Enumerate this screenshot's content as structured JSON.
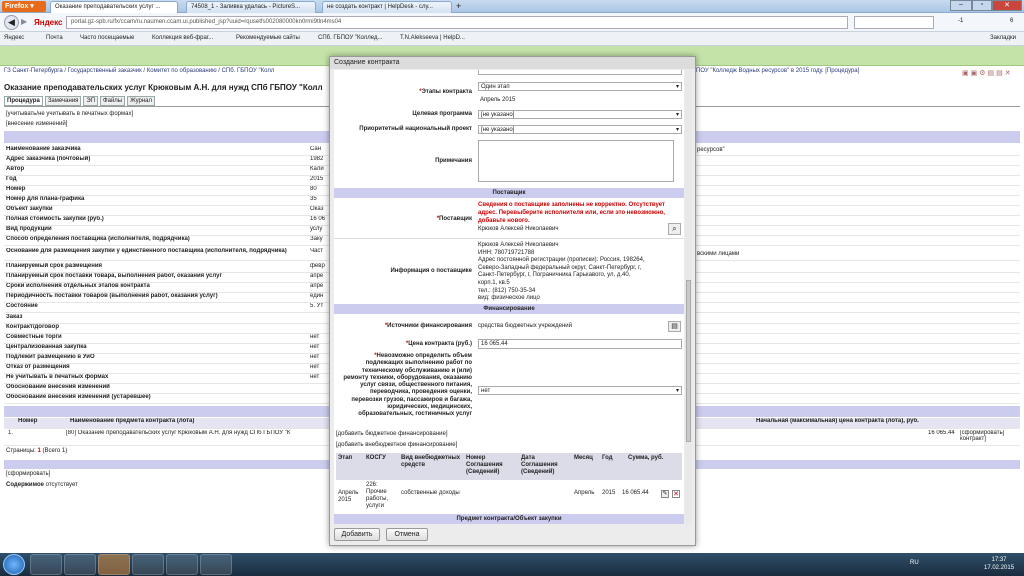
{
  "browser": {
    "brand": "Firefox",
    "tabs": [
      "Оказание преподавательских услуг ...",
      "74508_1 - Заливка удалась - PictureS...",
      "не создать контракт | HelpDesk - слу..."
    ],
    "url": "portal.gz-spb.ru/fx/ccam/ru.naumen.ccam.ui.published_jsp?uuid=rqusetfs002080000kn0rmi9tln4ms04",
    "search_engine": "Яндекс",
    "zoom": "-1",
    "bookmarks": [
      "Яндекс",
      "Почта",
      "Часто посещаемые",
      "Коллекция веб-фраг...",
      "Рекомендуемые сайты",
      "СПб. ГБПОУ \"Коллед...",
      "T.N.Alekseeva | HelpD..."
    ],
    "bookmarks_right": "Закладки",
    "badge": "6"
  },
  "breadcrumb": "ГЗ Санкт-Петербурга / Государственный заказчик / Комитет по образованию / СПб. ГБПОУ \"Колл",
  "breadcrumb_right": "ПОУ \"Колледж Водных ресурсов\" в 2015 году. [Процедура]",
  "page_title": "Оказание преподавательских услуг Крюковым А.Н. для нужд СПб ГБПОУ \"Колл",
  "tabs": [
    "Процедура",
    "Замечания",
    "ЭП",
    "Файлы",
    "Журнал"
  ],
  "notes": [
    "[учитывать/не учитывать в печатных формах]",
    "[внесение изменений]"
  ],
  "fields": [
    {
      "label": "Наименование заказчика",
      "value": "Сан"
    },
    {
      "label": "Адрес заказчика (почтовый)",
      "value": "1982"
    },
    {
      "label": "Автор",
      "value": "Кали"
    },
    {
      "label": "Год",
      "value": "2015"
    },
    {
      "label": "Номер",
      "value": "80"
    },
    {
      "label": "Номер для плана-графика",
      "value": "35"
    },
    {
      "label": "Объект закупки",
      "value": "Оказ"
    },
    {
      "label": "Полная стоимость закупки (руб.)",
      "value": "16 06"
    },
    {
      "label": "Вид продукции",
      "value": "услу"
    },
    {
      "label": "Способ определения поставщика (исполнителя, подрядчика)",
      "value": "Заку"
    },
    {
      "label": "Основание для размещения закупки у единственного поставщика (исполнителя, подрядчика)",
      "value": "Част"
    },
    {
      "label": "Планируемый срок размещения",
      "value": "февр"
    },
    {
      "label": "Планируемый срок поставки товара, выполнения работ, оказания услуг",
      "value": "апре"
    },
    {
      "label": "Сроки исполнения отдельных этапов контракта",
      "value": "апре"
    },
    {
      "label": "Периодичность поставки товаров (выполнения работ, оказания услуг)",
      "value": "един"
    },
    {
      "label": "Состояние",
      "value": "5. Ут"
    },
    {
      "label": "Заказ",
      "value": ""
    },
    {
      "label": "Контракт/договор",
      "value": ""
    },
    {
      "label": "Совместные торги",
      "value": "нет"
    },
    {
      "label": "Централизованная закупка",
      "value": "нет"
    },
    {
      "label": "Подлежит размещению в УиО",
      "value": "нет"
    },
    {
      "label": "Отказ от размещения",
      "value": "нет"
    },
    {
      "label": "Не учитывать в печатных формах",
      "value": "нет"
    },
    {
      "label": "Обоснование внесения изменений",
      "value": ""
    },
    {
      "label": "Обоснование внесения изменений (устаревшее)",
      "value": ""
    }
  ],
  "right_fragments": {
    "r1": "ресурсов\"",
    "r2": "вскими лицами"
  },
  "lots": {
    "col_num": "Номер",
    "col_name": "Наименование предмета контракта (лота)",
    "col_price": "Начальная (максимальная) цена контракта (лота), руб.",
    "row_num": "1.",
    "row_name": "[80] Оказание преподавательских услуг Крюковым А.Н. для нужд СПб ГБПОУ \"К",
    "row_price": "16 065.44",
    "row_action": "[сформировать] контракт]",
    "pages": "Страницы:",
    "page_current": "1",
    "page_all": "(Всего 1)"
  },
  "bottom": {
    "form": "[сформировать]",
    "content_label": "Содержимое",
    "content_value": "отсутствует"
  },
  "modal": {
    "title": "Создание контракта",
    "stages_label": "Этапы контракта",
    "stages_value": "Один этап",
    "stages_sub": "Апрель 2015",
    "target_label": "Целевая программа",
    "target_value": "[не указано]",
    "priority_label": "Приоритетный национальный проект",
    "priority_value": "[не указано]",
    "notes_label": "Примечания",
    "supplier_section": "Поставщик",
    "supplier_label": "Поставщик",
    "supplier_error": "Сведения о поставщике заполнены не корректно. Отсутствует адрес. Перевыберите исполнителя или, если это невозможно, добавьте нового.",
    "supplier_value": "Крюков Алексей Николаевич",
    "info_label": "Информация о поставщике",
    "info_lines": [
      "Крюков Алексей Николаевич",
      "ИНН: 780719721788",
      "Адрес постоянной регистрации (прописки): Россия, 198264,",
      "Северо-Западный федеральный округ, Санкт-Петербург, г,",
      "Санкт-Петербург, г, Пограничника Гарькавого, ул, д.40,",
      "корп.1, кв.5",
      "тел.: (812) 750-35-34",
      "вид: физическое лицо"
    ],
    "finance_section": "Финансирование",
    "source_label": "Источники финансирования",
    "source_value": "средства бюджетных учреждений",
    "price_label": "Цена контракта (руб.)",
    "price_value": "16 065.44",
    "reason_label": "Невозможно определить объем подлежащих выполнению работ по техническому обслуживанию и (или) ремонту техники, оборудования, оказанию услуг связи, общественного питания, переводчика, проведения оценки, перевозки грузов, пассажиров и багажа, юридических, медицинских, образовательных, гостиничных услуг",
    "reason_value": "нет",
    "add_budget": "[добавить бюджетное финансирование]",
    "add_extra": "[добавить внебюджетное финансирование]",
    "tbl_headers": [
      "Этап",
      "КОСГУ",
      "Вид внебюджетных средств",
      "Номер Соглашения (Сведений)",
      "Дата Соглашения (Сведений)",
      "Месяц",
      "Год",
      "Сумма, руб."
    ],
    "tbl_row": [
      "Апрель 2015",
      "226: Прочие работы, услуги",
      "собственные доходы",
      "",
      "",
      "Апрель",
      "2015",
      "16 065.44"
    ],
    "subject_section": "Предмет контракта/Объект закупки",
    "add_button": "Добавить",
    "cancel_button": "Отмена"
  },
  "taskbar": {
    "lang": "RU",
    "time": "17:37",
    "date": "17.02.2015"
  }
}
